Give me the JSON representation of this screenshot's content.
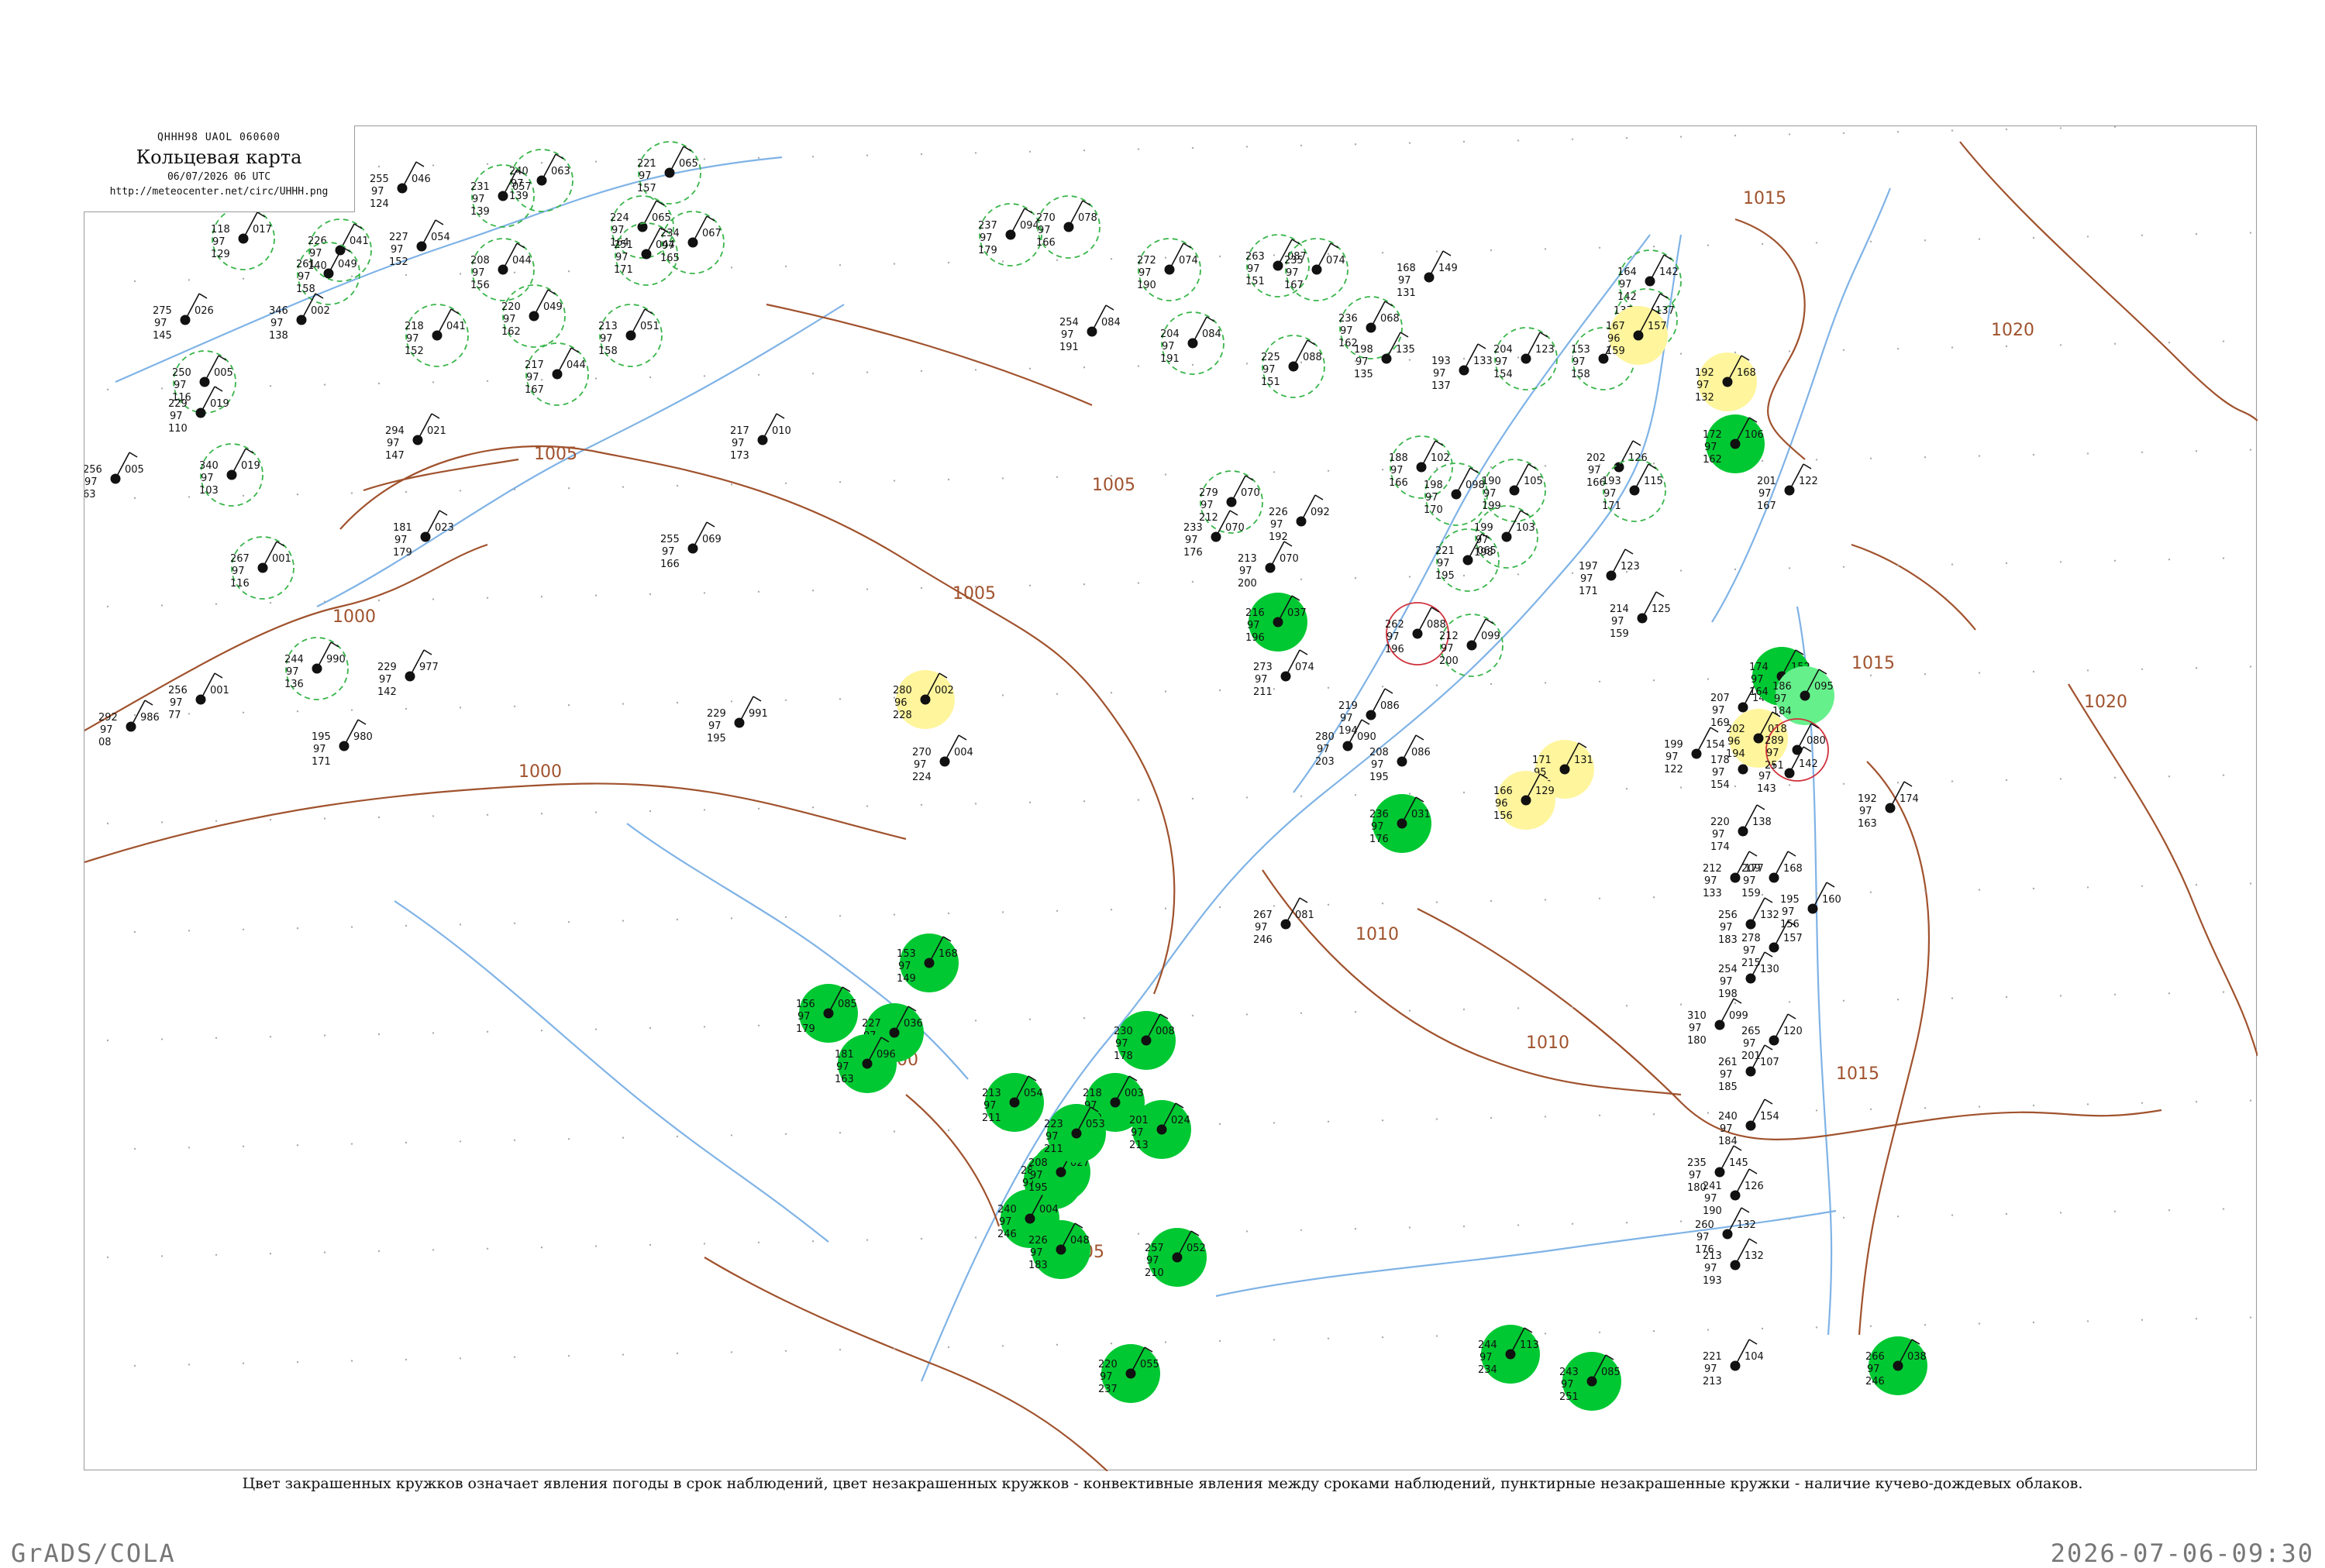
{
  "header": {
    "code": "QHHH98  UAOL  060600",
    "title": "Кольцевая карта",
    "datetime": "06/07/2026 06 UTC",
    "url": "http://meteocenter.net/circ/UHHH.png"
  },
  "caption": "Цвет закрашенных кружков означает явления погоды в срок наблюдений, цвет незакрашенных кружков - конвективные явления между сроками наблюдений, пунктирные незакрашенные кружки - наличие кучево-дождевых облаков.",
  "footer": {
    "left": "GrADS/COLA",
    "right": "2026-07-06-09:30"
  },
  "colors": {
    "precip_fill": "#00c832",
    "light_precip_fill": "#66f08c",
    "fog_fill": "#fff59d",
    "cb_ring": "#39b54a",
    "thunder_ring": "#d0303b",
    "isobar": "#a0522d",
    "river": "#7fb3e6",
    "frame": "#9a9a9a"
  },
  "isobars": [
    {
      "label": "1005"
    },
    {
      "label": "1000"
    },
    {
      "label": "1000"
    },
    {
      "label": "1005"
    },
    {
      "label": "1010"
    },
    {
      "label": "1015"
    },
    {
      "label": "1020"
    },
    {
      "label": "1015"
    },
    {
      "label": "1020"
    },
    {
      "label": "1010"
    },
    {
      "label": "1005"
    },
    {
      "label": "1000"
    },
    {
      "label": "1015"
    },
    {
      "label": "1005"
    }
  ],
  "stations": [
    {
      "t": "240",
      "p": "97",
      "d": "139",
      "c": "063",
      "kind": "cb"
    },
    {
      "t": "255",
      "p": "97",
      "d": "124",
      "c": "046",
      "kind": "plain"
    },
    {
      "t": "221",
      "p": "97",
      "d": "157",
      "c": "065",
      "kind": "cb"
    },
    {
      "t": "231",
      "p": "97",
      "d": "139",
      "c": "057",
      "kind": "cb"
    },
    {
      "t": "118",
      "p": "97",
      "d": "129",
      "c": "017",
      "kind": "cb"
    },
    {
      "t": "226",
      "p": "97",
      "d": "140",
      "c": "041",
      "kind": "cb"
    },
    {
      "t": "227",
      "p": "97",
      "d": "152",
      "c": "054",
      "kind": "plain"
    },
    {
      "t": "224",
      "p": "97",
      "d": "164",
      "c": "065",
      "kind": "cb"
    },
    {
      "t": "251",
      "p": "97",
      "d": "171",
      "c": "044",
      "kind": "cb"
    },
    {
      "t": "234",
      "p": "97",
      "d": "165",
      "c": "067",
      "kind": "cb"
    },
    {
      "t": "261",
      "p": "97",
      "d": "158",
      "c": "049",
      "kind": "cb"
    },
    {
      "t": "208",
      "p": "97",
      "d": "156",
      "c": "044",
      "kind": "cb"
    },
    {
      "t": "275",
      "p": "97",
      "d": "145",
      "c": "026",
      "kind": "plain"
    },
    {
      "t": "250",
      "p": "97",
      "d": "116",
      "c": "005",
      "kind": "cb"
    },
    {
      "t": "229",
      "p": "97",
      "d": "110",
      "c": "019",
      "kind": "plain"
    },
    {
      "t": "256",
      "p": "97",
      "d": "63",
      "c": "005",
      "kind": "plain"
    },
    {
      "t": "340",
      "p": "97",
      "d": "103",
      "c": "019",
      "kind": "cb"
    },
    {
      "t": "346",
      "p": "97",
      "d": "138",
      "c": "002",
      "kind": "plain"
    },
    {
      "t": "213",
      "p": "97",
      "d": "158",
      "c": "051",
      "kind": "cb"
    },
    {
      "t": "220",
      "p": "97",
      "d": "162",
      "c": "049",
      "kind": "cb"
    },
    {
      "t": "217",
      "p": "97",
      "d": "167",
      "c": "044",
      "kind": "cb"
    },
    {
      "t": "218",
      "p": "97",
      "d": "152",
      "c": "041",
      "kind": "cb"
    },
    {
      "t": "294",
      "p": "97",
      "d": "147",
      "c": "021",
      "kind": "plain"
    },
    {
      "t": "267",
      "p": "97",
      "d": "116",
      "c": "001",
      "kind": "cb"
    },
    {
      "t": "181",
      "p": "97",
      "d": "179",
      "c": "023",
      "kind": "plain"
    },
    {
      "t": "255",
      "p": "97",
      "d": "166",
      "c": "069",
      "kind": "plain"
    },
    {
      "t": "217",
      "p": "97",
      "d": "173",
      "c": "010",
      "kind": "plain"
    },
    {
      "t": "244",
      "p": "97",
      "d": "136",
      "c": "990",
      "kind": "cb"
    },
    {
      "t": "229",
      "p": "97",
      "d": "142",
      "c": "977",
      "kind": "plain"
    },
    {
      "t": "292",
      "p": "97",
      "d": "08",
      "c": "986",
      "kind": "plain"
    },
    {
      "t": "256",
      "p": "97",
      "d": "77",
      "c": "001",
      "kind": "plain"
    },
    {
      "t": "195",
      "p": "97",
      "d": "171",
      "c": "980",
      "kind": "plain"
    },
    {
      "t": "229",
      "p": "97",
      "d": "195",
      "c": "991",
      "kind": "plain"
    },
    {
      "t": "280",
      "p": "96",
      "d": "228",
      "c": "002",
      "kind": "fog"
    },
    {
      "t": "270",
      "p": "97",
      "d": "224",
      "c": "004",
      "kind": "plain"
    },
    {
      "t": "237",
      "p": "97",
      "d": "179",
      "c": "094",
      "kind": "cb"
    },
    {
      "t": "270",
      "p": "97",
      "d": "166",
      "c": "078",
      "kind": "cb"
    },
    {
      "t": "272",
      "p": "97",
      "d": "190",
      "c": "074",
      "kind": "cb"
    },
    {
      "t": "254",
      "p": "97",
      "d": "191",
      "c": "084",
      "kind": "plain"
    },
    {
      "t": "204",
      "p": "97",
      "d": "191",
      "c": "084",
      "kind": "cb"
    },
    {
      "t": "263",
      "p": "97",
      "d": "151",
      "c": "087",
      "kind": "cb"
    },
    {
      "t": "235",
      "p": "97",
      "d": "167",
      "c": "074",
      "kind": "cb"
    },
    {
      "t": "236",
      "p": "97",
      "d": "162",
      "c": "068",
      "kind": "cb"
    },
    {
      "t": "225",
      "p": "97",
      "d": "151",
      "c": "088",
      "kind": "cb"
    },
    {
      "t": "168",
      "p": "97",
      "d": "131",
      "c": "149",
      "kind": "plain"
    },
    {
      "t": "198",
      "p": "97",
      "d": "135",
      "c": "135",
      "kind": "plain"
    },
    {
      "t": "193",
      "p": "97",
      "d": "137",
      "c": "133",
      "kind": "plain"
    },
    {
      "t": "204",
      "p": "97",
      "d": "154",
      "c": "123",
      "kind": "cb"
    },
    {
      "t": "153",
      "p": "97",
      "d": "158",
      "c": "144",
      "kind": "cb"
    },
    {
      "t": "164",
      "p": "97",
      "d": "142",
      "c": "142",
      "kind": "cb"
    },
    {
      "t": "137",
      "p": "97",
      "d": "136",
      "c": "137",
      "kind": "cb"
    },
    {
      "t": "167",
      "p": "96",
      "d": "159",
      "c": "157",
      "kind": "fog"
    },
    {
      "t": "192",
      "p": "97",
      "d": "132",
      "c": "168",
      "kind": "fog"
    },
    {
      "t": "201",
      "p": "97",
      "d": "167",
      "c": "122",
      "kind": "plain"
    },
    {
      "t": "202",
      "p": "97",
      "d": "166",
      "c": "126",
      "kind": "plain"
    },
    {
      "t": "193",
      "p": "97",
      "d": "171",
      "c": "115",
      "kind": "cb"
    },
    {
      "t": "188",
      "p": "97",
      "d": "166",
      "c": "102",
      "kind": "cb"
    },
    {
      "t": "198",
      "p": "97",
      "d": "170",
      "c": "098",
      "kind": "cb"
    },
    {
      "t": "190",
      "p": "97",
      "d": "199",
      "c": "105",
      "kind": "cb"
    },
    {
      "t": "199",
      "p": "97",
      "d": "198",
      "c": "103",
      "kind": "cb"
    },
    {
      "t": "221",
      "p": "97",
      "d": "195",
      "c": "065",
      "kind": "cb"
    },
    {
      "t": "279",
      "p": "97",
      "d": "212",
      "c": "070",
      "kind": "cb"
    },
    {
      "t": "233",
      "p": "97",
      "d": "176",
      "c": "070",
      "kind": "plain"
    },
    {
      "t": "226",
      "p": "97",
      "d": "192",
      "c": "092",
      "kind": "plain"
    },
    {
      "t": "213",
      "p": "97",
      "d": "200",
      "c": "070",
      "kind": "plain"
    },
    {
      "t": "262",
      "p": "97",
      "d": "196",
      "c": "088",
      "kind": "thunder"
    },
    {
      "t": "212",
      "p": "97",
      "d": "200",
      "c": "099",
      "kind": "cb"
    },
    {
      "t": "273",
      "p": "97",
      "d": "211",
      "c": "074",
      "kind": "plain"
    },
    {
      "t": "219",
      "p": "97",
      "d": "194",
      "c": "086",
      "kind": "plain"
    },
    {
      "t": "280",
      "p": "97",
      "d": "203",
      "c": "090",
      "kind": "plain"
    },
    {
      "t": "208",
      "p": "97",
      "d": "195",
      "c": "086",
      "kind": "plain"
    },
    {
      "t": "171",
      "p": "95",
      "d": "166",
      "c": "131",
      "kind": "fog"
    },
    {
      "t": "166",
      "p": "96",
      "d": "156",
      "c": "129",
      "kind": "fog"
    },
    {
      "t": "153",
      "p": "96",
      "d": "145",
      "c": "177",
      "kind": "fog"
    },
    {
      "t": "197",
      "p": "97",
      "d": "171",
      "c": "123",
      "kind": "plain"
    },
    {
      "t": "214",
      "p": "97",
      "d": "159",
      "c": "125",
      "kind": "plain"
    },
    {
      "t": "207",
      "p": "97",
      "d": "169",
      "c": "145",
      "kind": "plain"
    },
    {
      "t": "199",
      "p": "97",
      "d": "122",
      "c": "154",
      "kind": "plain"
    },
    {
      "t": "178",
      "p": "97",
      "d": "154",
      "c": "149",
      "kind": "plain"
    },
    {
      "t": "184",
      "p": "97",
      "d": "143",
      "c": "142",
      "kind": "plain"
    },
    {
      "t": "192",
      "p": "97",
      "d": "163",
      "c": "174",
      "kind": "plain"
    },
    {
      "t": "220",
      "p": "97",
      "d": "174",
      "c": "138",
      "kind": "plain"
    },
    {
      "t": "212",
      "p": "97",
      "d": "133",
      "c": "177",
      "kind": "plain"
    },
    {
      "t": "209",
      "p": "97",
      "d": "159",
      "c": "168",
      "kind": "plain"
    },
    {
      "t": "195",
      "p": "97",
      "d": "156",
      "c": "160",
      "kind": "plain"
    },
    {
      "t": "256",
      "p": "97",
      "d": "183",
      "c": "132",
      "kind": "plain"
    },
    {
      "t": "278",
      "p": "97",
      "d": "215",
      "c": "157",
      "kind": "plain"
    },
    {
      "t": "254",
      "p": "97",
      "d": "198",
      "c": "130",
      "kind": "plain"
    },
    {
      "t": "310",
      "p": "97",
      "d": "180",
      "c": "099",
      "kind": "plain"
    },
    {
      "t": "265",
      "p": "97",
      "d": "201",
      "c": "120",
      "kind": "plain"
    },
    {
      "t": "261",
      "p": "97",
      "d": "185",
      "c": "107",
      "kind": "plain"
    },
    {
      "t": "240",
      "p": "97",
      "d": "184",
      "c": "154",
      "kind": "plain"
    },
    {
      "t": "235",
      "p": "97",
      "d": "180",
      "c": "145",
      "kind": "plain"
    },
    {
      "t": "241",
      "p": "97",
      "d": "190",
      "c": "126",
      "kind": "plain"
    },
    {
      "t": "260",
      "p": "97",
      "d": "176",
      "c": "132",
      "kind": "plain"
    },
    {
      "t": "213",
      "p": "97",
      "d": "193",
      "c": "132",
      "kind": "plain"
    },
    {
      "t": "221",
      "p": "97",
      "d": "213",
      "c": "104",
      "kind": "plain"
    },
    {
      "t": "244",
      "p": "97",
      "d": "234",
      "c": "113",
      "kind": "precip"
    },
    {
      "t": "243",
      "p": "97",
      "d": "251",
      "c": "085",
      "kind": "precip"
    },
    {
      "t": "266",
      "p": "97",
      "d": "246",
      "c": "038",
      "kind": "precip"
    },
    {
      "t": "285",
      "p": "97",
      "d": "254",
      "c": "011",
      "kind": "precip"
    },
    {
      "t": "240",
      "p": "97",
      "d": "246",
      "c": "004",
      "kind": "precip"
    },
    {
      "t": "226",
      "p": "97",
      "d": "183",
      "c": "048",
      "kind": "precip"
    },
    {
      "t": "257",
      "p": "97",
      "d": "210",
      "c": "052",
      "kind": "precip"
    },
    {
      "t": "220",
      "p": "97",
      "d": "237",
      "c": "055",
      "kind": "precip"
    },
    {
      "t": "236",
      "p": "97",
      "d": "176",
      "c": "031",
      "kind": "precip"
    },
    {
      "t": "230",
      "p": "97",
      "d": "178",
      "c": "008",
      "kind": "precip"
    },
    {
      "t": "218",
      "p": "97",
      "d": "190",
      "c": "003",
      "kind": "precip"
    },
    {
      "t": "201",
      "p": "97",
      "d": "213",
      "c": "024",
      "kind": "precip"
    },
    {
      "t": "208",
      "p": "97",
      "d": "195",
      "c": "027",
      "kind": "precip"
    },
    {
      "t": "216",
      "p": "97",
      "d": "196",
      "c": "037",
      "kind": "precip"
    },
    {
      "t": "223",
      "p": "97",
      "d": "211",
      "c": "053",
      "kind": "precip"
    },
    {
      "t": "213",
      "p": "97",
      "d": "211",
      "c": "054",
      "kind": "precip"
    },
    {
      "t": "227",
      "p": "97",
      "d": "207",
      "c": "036",
      "kind": "precip"
    },
    {
      "t": "181",
      "p": "97",
      "d": "163",
      "c": "096",
      "kind": "precip"
    },
    {
      "t": "156",
      "p": "97",
      "d": "179",
      "c": "085",
      "kind": "precip"
    },
    {
      "t": "153",
      "p": "97",
      "d": "149",
      "c": "168",
      "kind": "precip"
    },
    {
      "t": "172",
      "p": "97",
      "d": "162",
      "c": "106",
      "kind": "precip"
    },
    {
      "t": "174",
      "p": "97",
      "d": "164",
      "c": "152",
      "kind": "precip"
    },
    {
      "t": "186",
      "p": "97",
      "d": "184",
      "c": "095",
      "kind": "light"
    },
    {
      "t": "202",
      "p": "96",
      "d": "194",
      "c": "018",
      "kind": "fog"
    },
    {
      "t": "289",
      "p": "97",
      "d": "251",
      "c": "080",
      "kind": "thunder"
    },
    {
      "t": "267",
      "p": "97",
      "d": "246",
      "c": "081",
      "kind": "plain"
    }
  ]
}
